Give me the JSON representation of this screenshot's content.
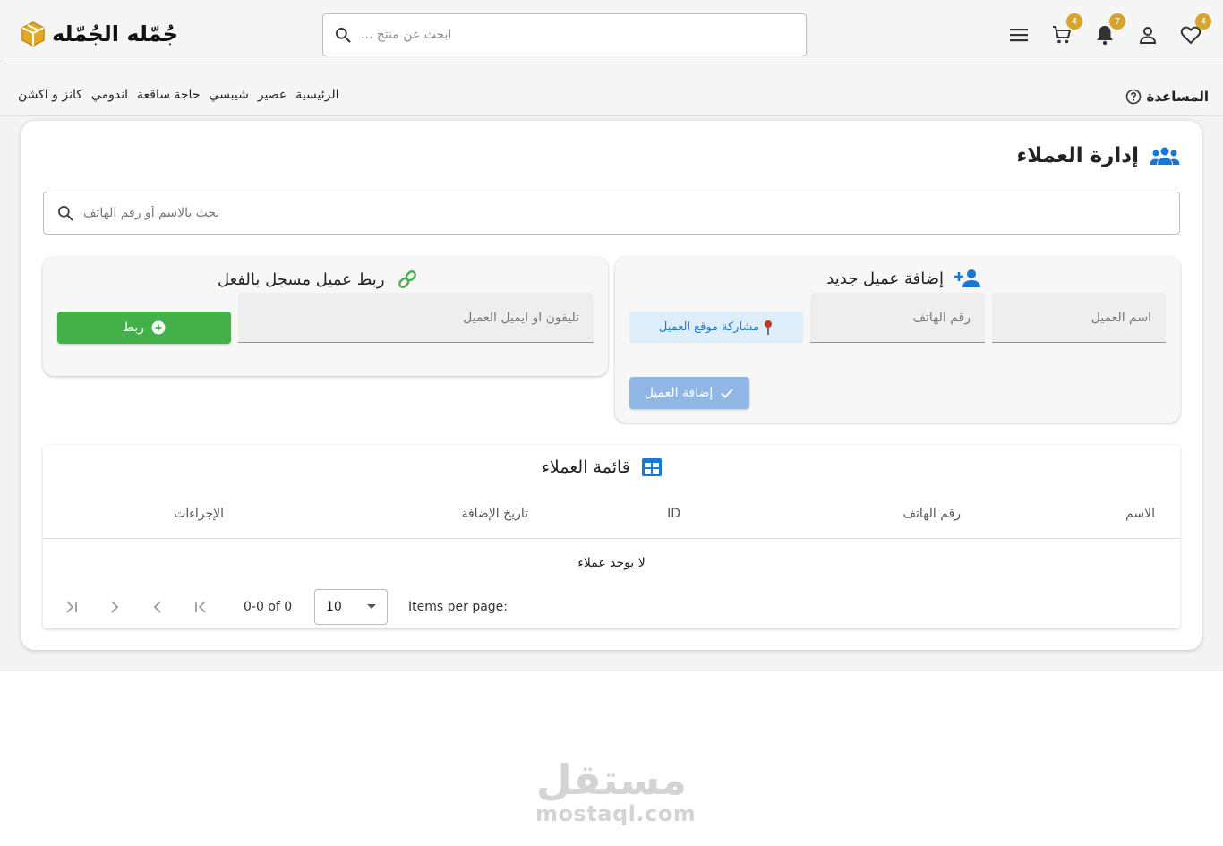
{
  "header": {
    "logo_text": "جُمّله الجُمّله",
    "search_placeholder": "ابحث عن منتج ...",
    "badges": {
      "favorites": "4",
      "notifications": "7",
      "cart": "4"
    },
    "icons": [
      "heart-icon",
      "account-icon",
      "bell-icon",
      "cart-icon",
      "menu-icon",
      "search-icon"
    ]
  },
  "nav": {
    "links": [
      "الرئيسية",
      "عصير",
      "شيبسي",
      "حاجة ساقعة",
      "اندومي",
      "كانز و اكشن"
    ],
    "help_label": "المساعدة"
  },
  "page": {
    "title": "إدارة العملاء",
    "search_placeholder": "بحث بالاسم أو رقم الهاتف"
  },
  "add_customer": {
    "title": "إضافة عميل جديد",
    "name_placeholder": "اسم العميل",
    "phone_placeholder": "رقم الهاتف",
    "share_location_label": "مشاركة موقع العميل",
    "add_button_label": "إضافة العميل"
  },
  "link_customer": {
    "title": "ربط عميل مسجل بالفعل",
    "input_placeholder": "تليفون او ايميل العميل",
    "link_button_label": "ربط"
  },
  "customer_list": {
    "title": "قائمة العملاء",
    "columns": [
      "الاسم",
      "رقم الهاتف",
      "ID",
      "تاريخ الإضافة",
      "الإجراءات"
    ],
    "empty_text": "لا يوجد عملاء",
    "items_per_page_label": "Items per page:",
    "page_size": "10",
    "range_label": "0-0 of 0"
  },
  "watermark": {
    "arabic": "مستقل",
    "latin": "mostaql.com"
  },
  "colors": {
    "accent_gold": "#d5a42a",
    "primary_blue": "#1976d2",
    "green": "#43b04a"
  }
}
